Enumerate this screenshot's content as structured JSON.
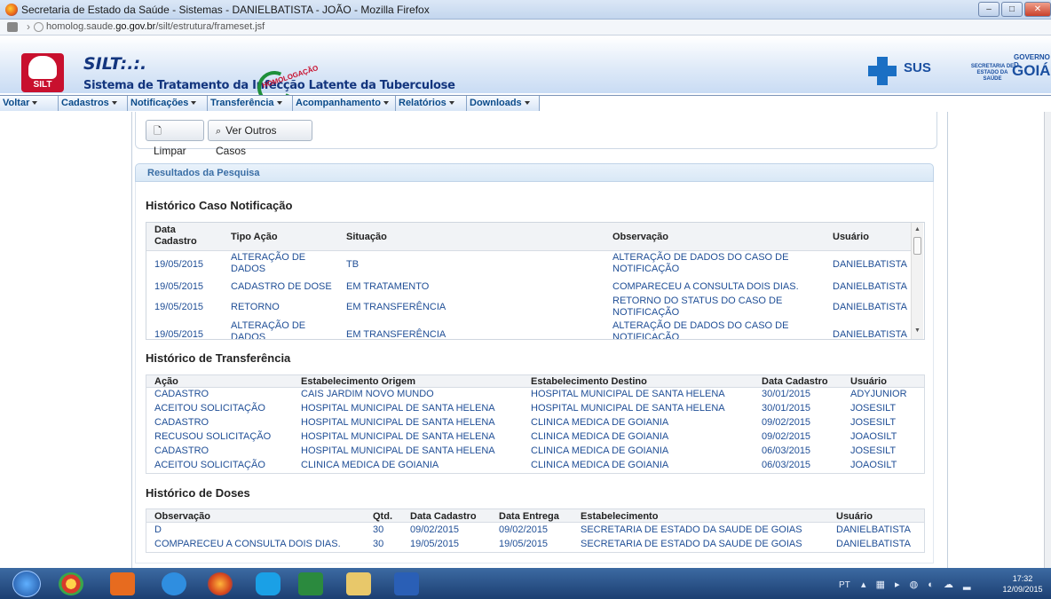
{
  "window": {
    "title": "Secretaria de Estado da Saúde - Sistemas - DANIELBATISTA - JOÃO - Mozilla Firefox",
    "url_prefix": "homolog.saude.",
    "url_domain": "go.gov.br",
    "url_path": "/silt/estrutura/frameset.jsf"
  },
  "header": {
    "app_name": "SILT:.:.",
    "app_subtitle": "Sistema de Tratamento da Infecção Latente da Tuberculose",
    "logo_label": "SILT",
    "stamp": "HOMOLOGAÇÃO",
    "sus": "SUS",
    "secretaria": "SECRETARIA DE ESTADO DA SAÚDE",
    "gov_line1": "GOVERNO D",
    "gov_line2": "GOIÁS"
  },
  "menu": [
    "Voltar",
    "Cadastros",
    "Notificações",
    "Transferência",
    "Acompanhamento",
    "Relatórios",
    "Downloads"
  ],
  "buttons": {
    "limpar": "Limpar",
    "ver_outros": "Ver Outros Casos"
  },
  "results_title": "Resultados da Pesquisa",
  "notificacao": {
    "title": "Histórico Caso Notificação",
    "headers": [
      "Data Cadastro",
      "Tipo Ação",
      "Situação",
      "Observação",
      "Usuário"
    ],
    "rows": [
      [
        "19/05/2015",
        "ALTERAÇÃO DE DADOS",
        "TB",
        "ALTERAÇÃO DE DADOS DO CASO DE NOTIFICAÇÃO",
        "DANIELBATISTA"
      ],
      [
        "19/05/2015",
        "CADASTRO DE DOSE",
        "EM TRATAMENTO",
        "COMPARECEU A CONSULTA DOIS DIAS.",
        "DANIELBATISTA"
      ],
      [
        "19/05/2015",
        "RETORNO",
        "EM TRANSFERÊNCIA",
        "RETORNO DO STATUS DO CASO DE NOTIFICAÇÃO",
        "DANIELBATISTA"
      ],
      [
        "19/05/2015",
        "ALTERAÇÃO DE DADOS",
        "EM TRANSFERÊNCIA",
        "ALTERAÇÃO DE DADOS DO CASO DE NOTIFICAÇÃO",
        "DANIELBATISTA"
      ]
    ]
  },
  "transferencia": {
    "title": "Histórico de Transferência",
    "headers": [
      "Ação",
      "Estabelecimento Origem",
      "Estabelecimento Destino",
      "Data Cadastro",
      "Usuário"
    ],
    "rows": [
      [
        "CADASTRO",
        "CAIS JARDIM NOVO MUNDO",
        "HOSPITAL MUNICIPAL DE SANTA HELENA",
        "30/01/2015",
        "ADYJUNIOR"
      ],
      [
        "ACEITOU SOLICITAÇÃO",
        "HOSPITAL MUNICIPAL DE SANTA HELENA",
        "HOSPITAL MUNICIPAL DE SANTA HELENA",
        "30/01/2015",
        "JOSESILT"
      ],
      [
        "CADASTRO",
        "HOSPITAL MUNICIPAL DE SANTA HELENA",
        "CLINICA MEDICA DE GOIANIA",
        "09/02/2015",
        "JOSESILT"
      ],
      [
        "RECUSOU SOLICITAÇÃO",
        "HOSPITAL MUNICIPAL DE SANTA HELENA",
        "CLINICA MEDICA DE GOIANIA",
        "09/02/2015",
        "JOAOSILT"
      ],
      [
        "CADASTRO",
        "HOSPITAL MUNICIPAL DE SANTA HELENA",
        "CLINICA MEDICA DE GOIANIA",
        "06/03/2015",
        "JOSESILT"
      ],
      [
        "ACEITOU SOLICITAÇÃO",
        "CLINICA MEDICA DE GOIANIA",
        "CLINICA MEDICA DE GOIANIA",
        "06/03/2015",
        "JOAOSILT"
      ]
    ]
  },
  "doses": {
    "title": "Histórico de Doses",
    "headers": [
      "Observação",
      "Qtd.",
      "Data Cadastro",
      "Data Entrega",
      "Estabelecimento",
      "Usuário"
    ],
    "rows": [
      [
        "D",
        "30",
        "09/02/2015",
        "09/02/2015",
        "SECRETARIA DE ESTADO DA SAUDE DE GOIAS",
        "DANIELBATISTA"
      ],
      [
        "COMPARECEU A CONSULTA DOIS DIAS.",
        "30",
        "19/05/2015",
        "19/05/2015",
        "SECRETARIA DE ESTADO DA SAUDE DE GOIAS",
        "DANIELBATISTA"
      ]
    ]
  },
  "taskbar": {
    "lang": "PT",
    "time": "17:32",
    "date": "12/09/2015"
  },
  "colors": {
    "link_blue": "#1f4e96",
    "menu_blue": "#0b4b8a",
    "brand_red": "#c8102e"
  }
}
